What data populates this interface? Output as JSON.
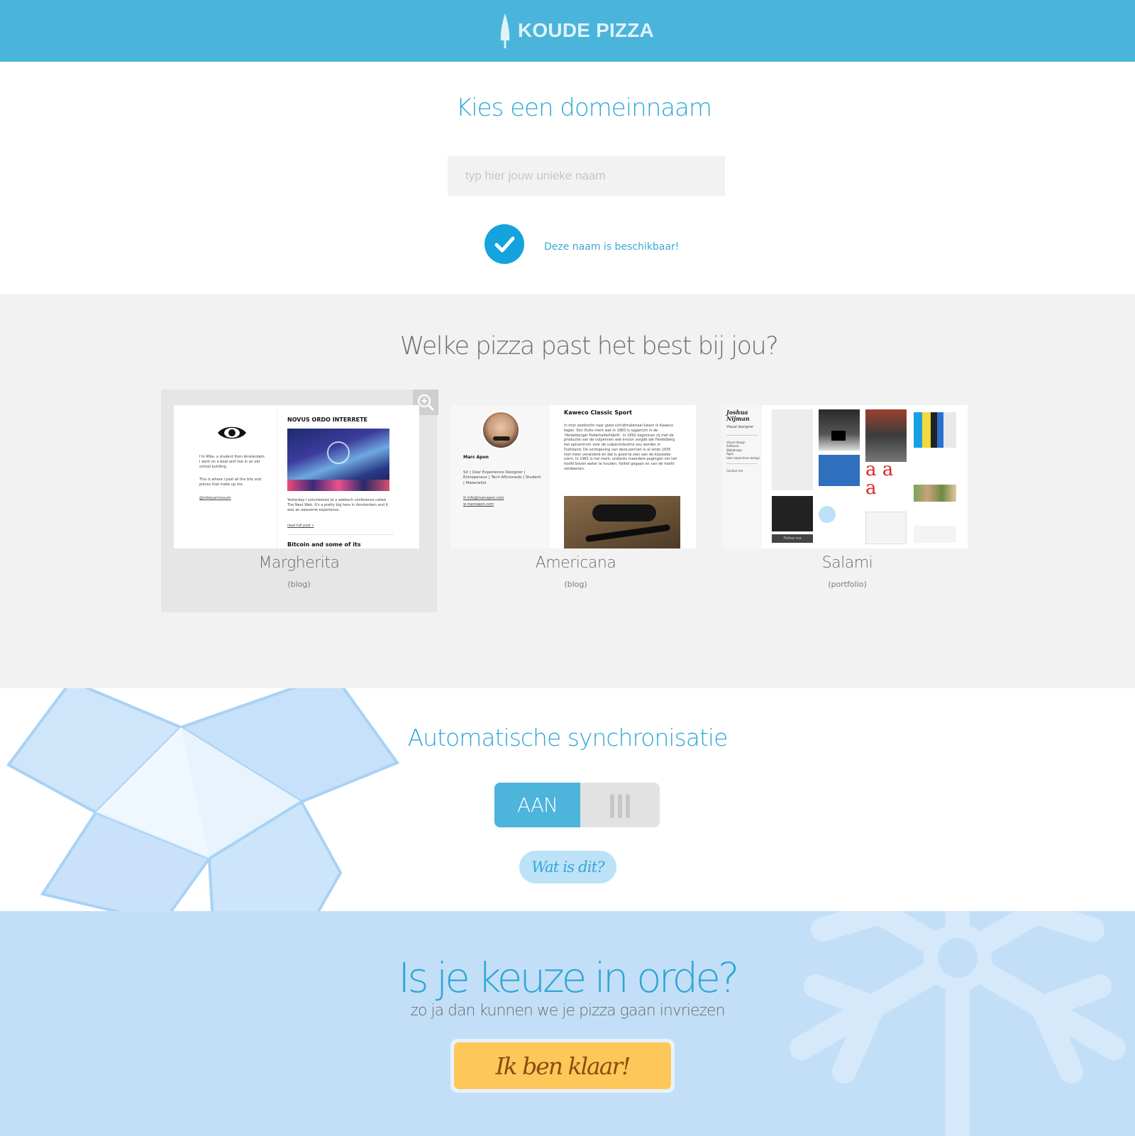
{
  "header": {
    "logo_text": "KOUDE PIZZA",
    "logo_icon": "tree-icon",
    "color": "#4ab4da"
  },
  "domain": {
    "title": "Kies een domeinnaam",
    "input_placeholder": "typ hier jouw unieke naam",
    "input_value": "",
    "status_icon": "check-icon",
    "status_text": "Deze naam is beschikbaar!"
  },
  "pizza": {
    "title": "Welke pizza past het best bij jou?",
    "zoom_icon": "zoom-in-icon",
    "options": [
      {
        "name": "Margherita",
        "type": "(blog)",
        "selected": true,
        "preview": {
          "heading": "NOVUS ORDO INTERRETE",
          "intro": "I'm Mike, a student from Amsterdam. I work on a boat and live in an old school building.",
          "intro2": "This is where I post all the bits and pieces that make up me.",
          "handle": "@mikeyanrossum",
          "body": "Yesterday I volunteered at a webtech conference called The Next Web. It's a pretty big here in Amsterdam and it was an awesome experience.",
          "read_more": "read full post »",
          "heading2": "Bitcoin and some of its"
        }
      },
      {
        "name": "Americana",
        "type": "(blog)",
        "selected": false,
        "preview": {
          "author": "Marc Apon",
          "bio": "Sir | User Experience Designer | Entrepeneur | Tech Aficionado | Student | Materialist",
          "email": "info@marcapon.com",
          "web": "marcapon.com",
          "heading": "Kaweco Classic Sport",
          "body": "In mijn zoektocht naar goed schrijfmateriaal kwam ik Kaweco tegen. Een Duits merk wat in 1883 is opgericht in de 'Heidelberger Federhalterfabrik'. In 1892 begonnen zij met de productie van de vulpennen wat ervoor zorgde dat Heidelberg het epicentrum voor de vulpenindustrie zou worden in Duitsland. De vormgeving van deze pennen is al sinds 1935 niet meer veranderd en dat is goed te zien aan de klassieke vorm. In 1981 is het merk, ondanks meerdere pogingen om het hoofd boven water te houden, failliet gegaan en van de markt verdwenen."
        }
      },
      {
        "name": "Salami",
        "type": "(portfolio)",
        "selected": false,
        "preview": {
          "owner": "Joshua Nijman",
          "role": "Visual designer",
          "menu": [
            "Visual design",
            "Software",
            "Webdesign",
            "Apps",
            "User experience design"
          ],
          "contact": "Contact me",
          "tile_label": "Follow me"
        }
      }
    ]
  },
  "sync": {
    "title": "Automatische synchronisatie",
    "toggle_label": "AAN",
    "toggle_on": true,
    "help_button": "Wat is dit?",
    "bg_icon": "dropbox-logo-icon"
  },
  "confirm": {
    "title": "Is je keuze in orde?",
    "subtitle": "zo ja dan kunnen we je pizza gaan invriezen",
    "button": "Ik ben klaar!",
    "bg_icon": "snowflake-icon"
  }
}
